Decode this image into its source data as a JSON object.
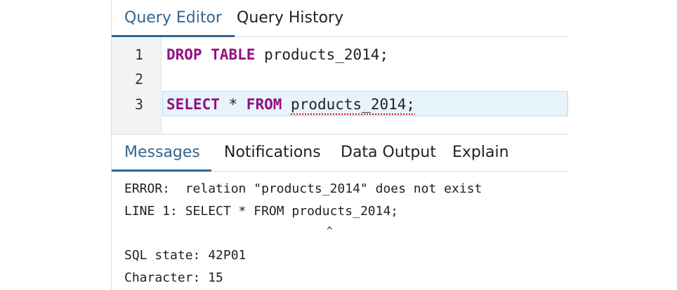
{
  "top_tabs": [
    {
      "label": "Query Editor",
      "active": true
    },
    {
      "label": "Query History",
      "active": false
    }
  ],
  "editor": {
    "lines": [
      {
        "number": "1",
        "keyword1": "DROP TABLE",
        "rest": " products_2014;"
      },
      {
        "number": "2"
      },
      {
        "number": "3",
        "keyword1": "SELECT",
        "mid": " * ",
        "keyword2": "FROM",
        "space": " ",
        "error_text": "products_2014;"
      }
    ]
  },
  "bottom_tabs": [
    {
      "label": "Messages",
      "active": true
    },
    {
      "label": "Notifications",
      "active": false
    },
    {
      "label": "Data Output",
      "active": false
    },
    {
      "label": "Explain",
      "active": false
    }
  ],
  "messages": {
    "line1": "ERROR:  relation \"products_2014\" does not exist",
    "line2": "LINE 1: SELECT * FROM products_2014;",
    "caret": "^",
    "line3": "SQL state: 42P01",
    "line4": "Character: 15"
  },
  "colors": {
    "accent": "#326690",
    "keyword": "#930f80",
    "error_underline": "#d01c1c",
    "current_line_bg": "#e8f4fb"
  }
}
